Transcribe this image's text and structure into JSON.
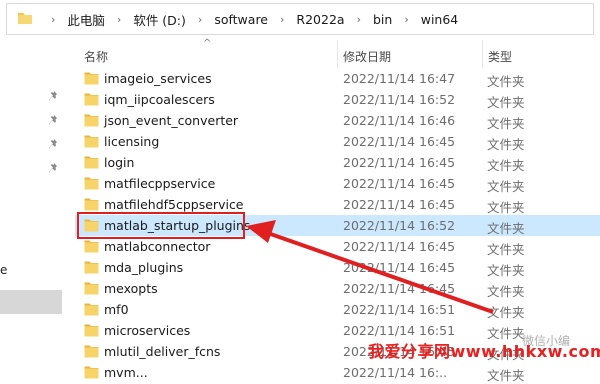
{
  "breadcrumb": [
    "此电脑",
    "软件 (D:)",
    "software",
    "R2022a",
    "bin",
    "win64"
  ],
  "columns": {
    "name": "名称",
    "date": "修改日期",
    "type": "类型"
  },
  "left_label": "e",
  "rows": [
    {
      "name": "imageio_services",
      "date": "2022/11/14 16:47",
      "type": "文件夹"
    },
    {
      "name": "iqm_iipcoalescers",
      "date": "2022/11/14 16:52",
      "type": "文件夹"
    },
    {
      "name": "json_event_converter",
      "date": "2022/11/14 16:46",
      "type": "文件夹"
    },
    {
      "name": "licensing",
      "date": "2022/11/14 16:45",
      "type": "文件夹"
    },
    {
      "name": "login",
      "date": "2022/11/14 16:45",
      "type": "文件夹"
    },
    {
      "name": "matfilecppservice",
      "date": "2022/11/14 16:45",
      "type": "文件夹"
    },
    {
      "name": "matfilehdf5cppservice",
      "date": "2022/11/14 16:45",
      "type": "文件夹"
    },
    {
      "name": "matlab_startup_plugins",
      "date": "2022/11/14 16:52",
      "type": "文件夹"
    },
    {
      "name": "matlabconnector",
      "date": "2022/11/14 16:45",
      "type": "文件夹"
    },
    {
      "name": "mda_plugins",
      "date": "2022/11/14 16:45",
      "type": "文件夹"
    },
    {
      "name": "mexopts",
      "date": "2022/11/14 16:45",
      "type": "文件夹"
    },
    {
      "name": "mf0",
      "date": "2022/11/14 16:51",
      "type": "文件夹"
    },
    {
      "name": "microservices",
      "date": "2022/11/14 16:51",
      "type": "文件夹"
    },
    {
      "name": "mlutil_deliver_fcns",
      "date": "2022/11/14 16:45",
      "type": "文件夹"
    },
    {
      "name": "mvm...",
      "date": "2022/11/14 16:..",
      "type": "文件夹"
    }
  ],
  "selected_index": 7,
  "watermark": {
    "site": "我爱分享网www.hhkxw.com",
    "note": "微信小编"
  },
  "colors": {
    "selection": "#cce8ff",
    "folder": "#f3c54b",
    "annotation": "#e02020"
  },
  "icons": {
    "folder": "folder-icon",
    "pin": "pin-icon",
    "chevron": "chevron-right-icon"
  }
}
